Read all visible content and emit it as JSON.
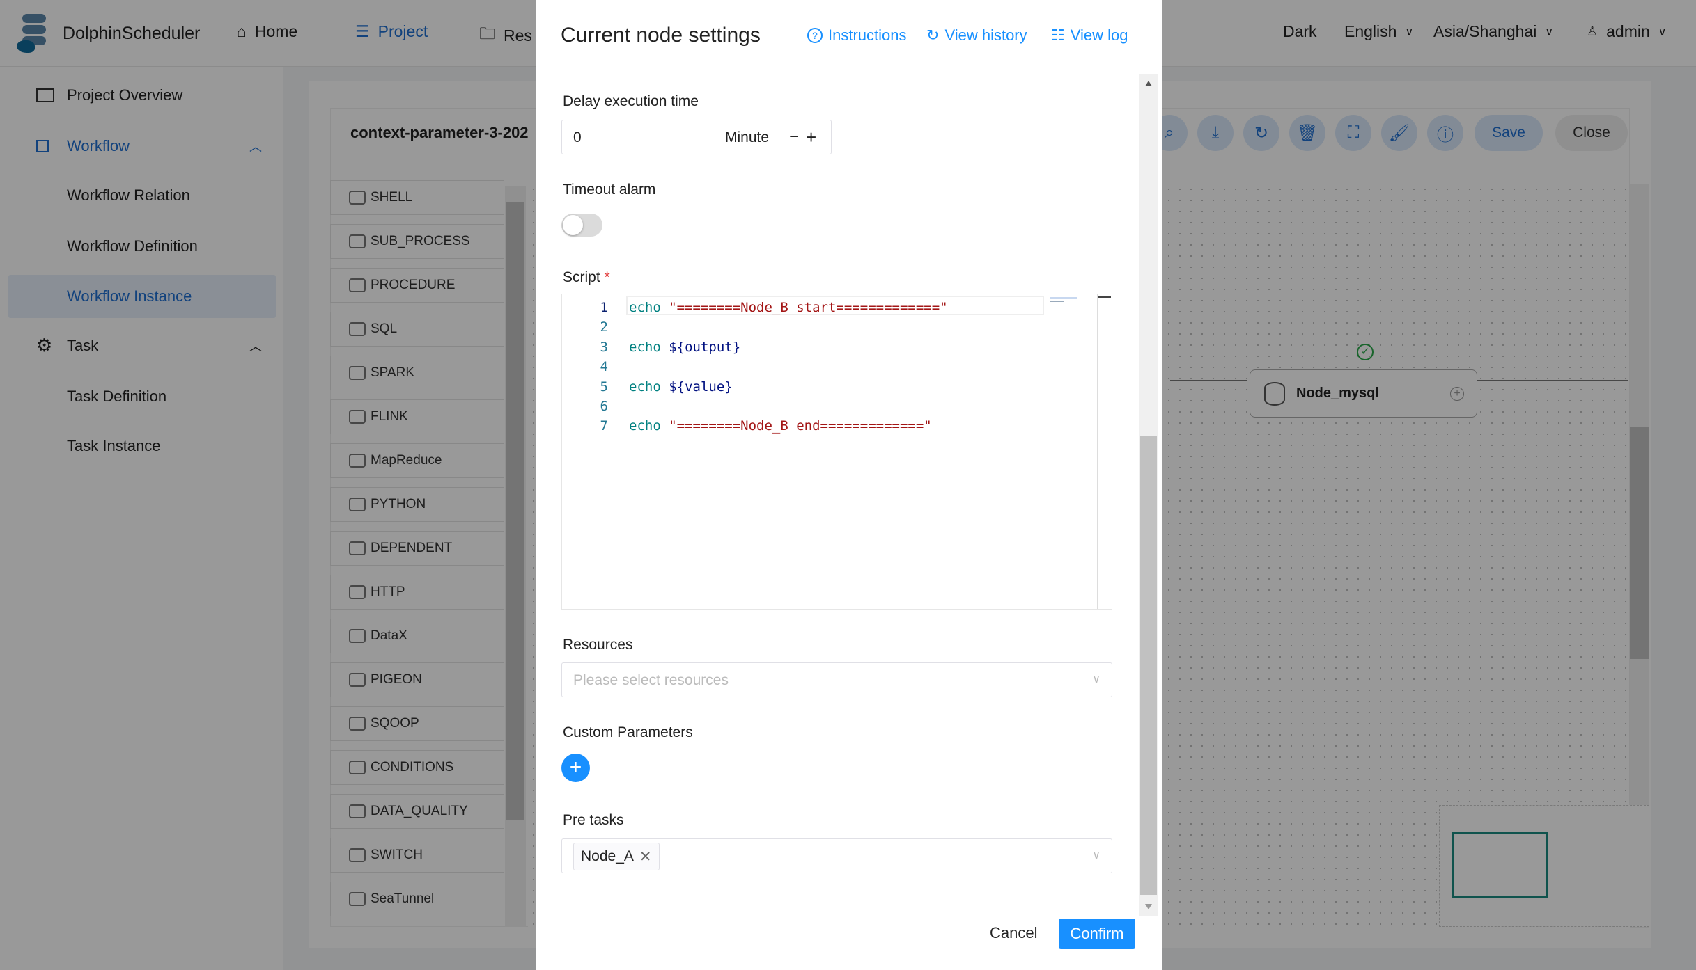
{
  "app": {
    "name": "DolphinScheduler"
  },
  "nav": [
    {
      "label": "Home",
      "icon": "home-icon"
    },
    {
      "label": "Project",
      "icon": "project-icon",
      "active": true
    },
    {
      "label": "Res",
      "icon": "folder-icon"
    }
  ],
  "header_right": {
    "theme": "Dark",
    "language": "English",
    "timezone": "Asia/Shanghai",
    "user": "admin"
  },
  "sidebar": {
    "items": [
      {
        "label": "Project Overview"
      },
      {
        "label": "Workflow"
      },
      {
        "label": "Workflow Relation"
      },
      {
        "label": "Workflow Definition"
      },
      {
        "label": "Workflow Instance",
        "active": true
      },
      {
        "label": "Task"
      },
      {
        "label": "Task Definition"
      },
      {
        "label": "Task Instance"
      }
    ]
  },
  "workflow": {
    "title": "context-parameter-3-202",
    "save": "Save",
    "close": "Close",
    "tasks": [
      "SHELL",
      "SUB_PROCESS",
      "PROCEDURE",
      "SQL",
      "SPARK",
      "FLINK",
      "MapReduce",
      "PYTHON",
      "DEPENDENT",
      "HTTP",
      "DataX",
      "PIGEON",
      "SQOOP",
      "CONDITIONS",
      "DATA_QUALITY",
      "SWITCH",
      "SeaTunnel"
    ],
    "node": {
      "name": "Node_mysql",
      "status": "success"
    }
  },
  "modal": {
    "title": "Current node settings",
    "instructions": "Instructions",
    "view_history": "View history",
    "view_log": "View log",
    "delay_label": "Delay execution time",
    "delay_value": "0",
    "delay_unit": "Minute",
    "timeout_label": "Timeout alarm",
    "timeout_enabled": false,
    "script_label": "Script",
    "required_mark": "*",
    "script": [
      {
        "n": "1",
        "kw": "echo",
        "rest": "\"========Node_B start=============\"",
        "type": "str"
      },
      {
        "n": "2",
        "kw": "",
        "rest": "",
        "type": ""
      },
      {
        "n": "3",
        "kw": "echo",
        "rest": "${output}",
        "type": "var"
      },
      {
        "n": "4",
        "kw": "",
        "rest": "",
        "type": ""
      },
      {
        "n": "5",
        "kw": "echo",
        "rest": "${value}",
        "type": "var"
      },
      {
        "n": "6",
        "kw": "",
        "rest": "",
        "type": ""
      },
      {
        "n": "7",
        "kw": "echo",
        "rest": "\"========Node_B end=============\"",
        "type": "str"
      }
    ],
    "resources_label": "Resources",
    "resources_placeholder": "Please select resources",
    "custom_params_label": "Custom Parameters",
    "pre_tasks_label": "Pre tasks",
    "pre_tasks": [
      "Node_A"
    ],
    "cancel": "Cancel",
    "confirm": "Confirm"
  },
  "colors": {
    "primary": "#1890ff",
    "accent": "#1e6fd0",
    "minimap": "#1a8a80"
  }
}
